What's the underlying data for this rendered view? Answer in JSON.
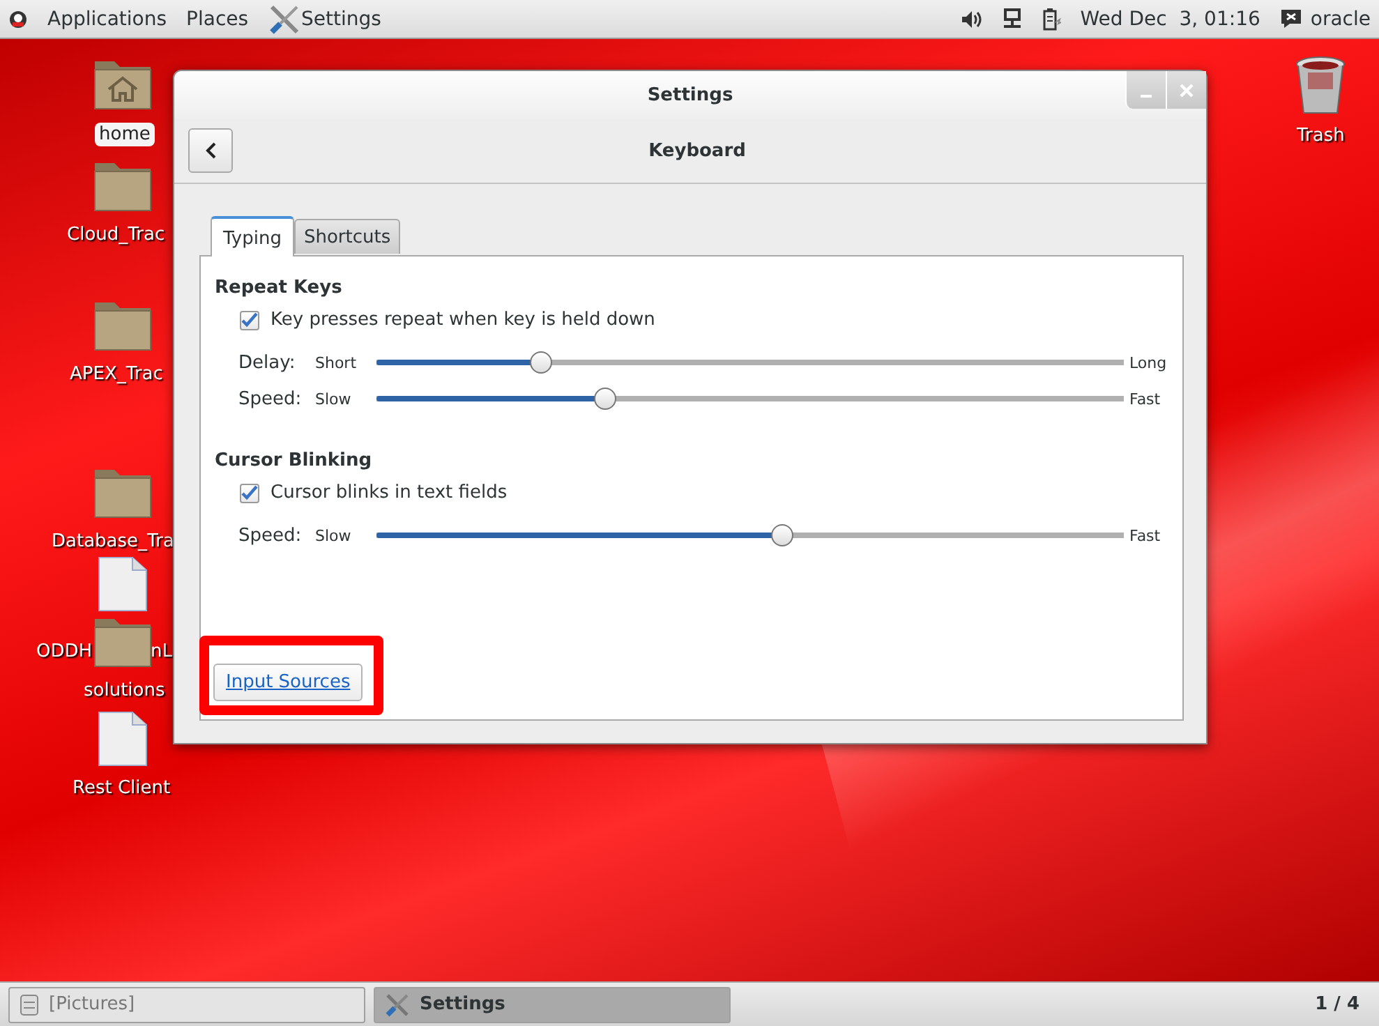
{
  "top_bar": {
    "menus": [
      "Applications",
      "Places"
    ],
    "app_title": "Settings",
    "clock": "Wed Dec  3, 01:16",
    "user": "oracle"
  },
  "desktop_icons": [
    {
      "kind": "home",
      "label": "home"
    },
    {
      "kind": "folder",
      "label": "Cloud_Trac"
    },
    {
      "kind": "folder",
      "label": "APEX_Trac"
    },
    {
      "kind": "folder",
      "label": "Database_Tra"
    },
    {
      "kind": "file",
      "label": "ODDH"
    },
    {
      "kind": "text",
      "label": "nL"
    },
    {
      "kind": "folder",
      "label": "solutions"
    },
    {
      "kind": "file",
      "label": "Rest Client"
    },
    {
      "kind": "trash",
      "label": "Trash"
    }
  ],
  "window": {
    "title": "Settings",
    "page_title": "Keyboard",
    "tabs": [
      {
        "label": "Typing",
        "selected": true
      },
      {
        "label": "Shortcuts",
        "selected": false
      }
    ],
    "sections": [
      {
        "heading": "Repeat Keys",
        "checkbox": {
          "label": "Key presses repeat when key is held down",
          "checked": true
        },
        "sliders": [
          {
            "label": "Delay:",
            "min_label": "Short",
            "max_label": "Long",
            "level": 0.22
          },
          {
            "label": "Speed:",
            "min_label": "Slow",
            "max_label": "Fast",
            "level": 0.306
          }
        ]
      },
      {
        "heading": "Cursor Blinking",
        "checkbox": {
          "label": "Cursor blinks in text fields",
          "checked": true
        },
        "sliders": [
          {
            "label": "Speed:",
            "min_label": "Slow",
            "max_label": "Fast",
            "level": 0.543
          }
        ]
      }
    ],
    "link_button": "Input Sources"
  },
  "taskbar": {
    "items": [
      {
        "label": "[Pictures]",
        "selected": false
      },
      {
        "label": "Settings",
        "selected": true
      }
    ],
    "workspace": "1 / 4"
  }
}
